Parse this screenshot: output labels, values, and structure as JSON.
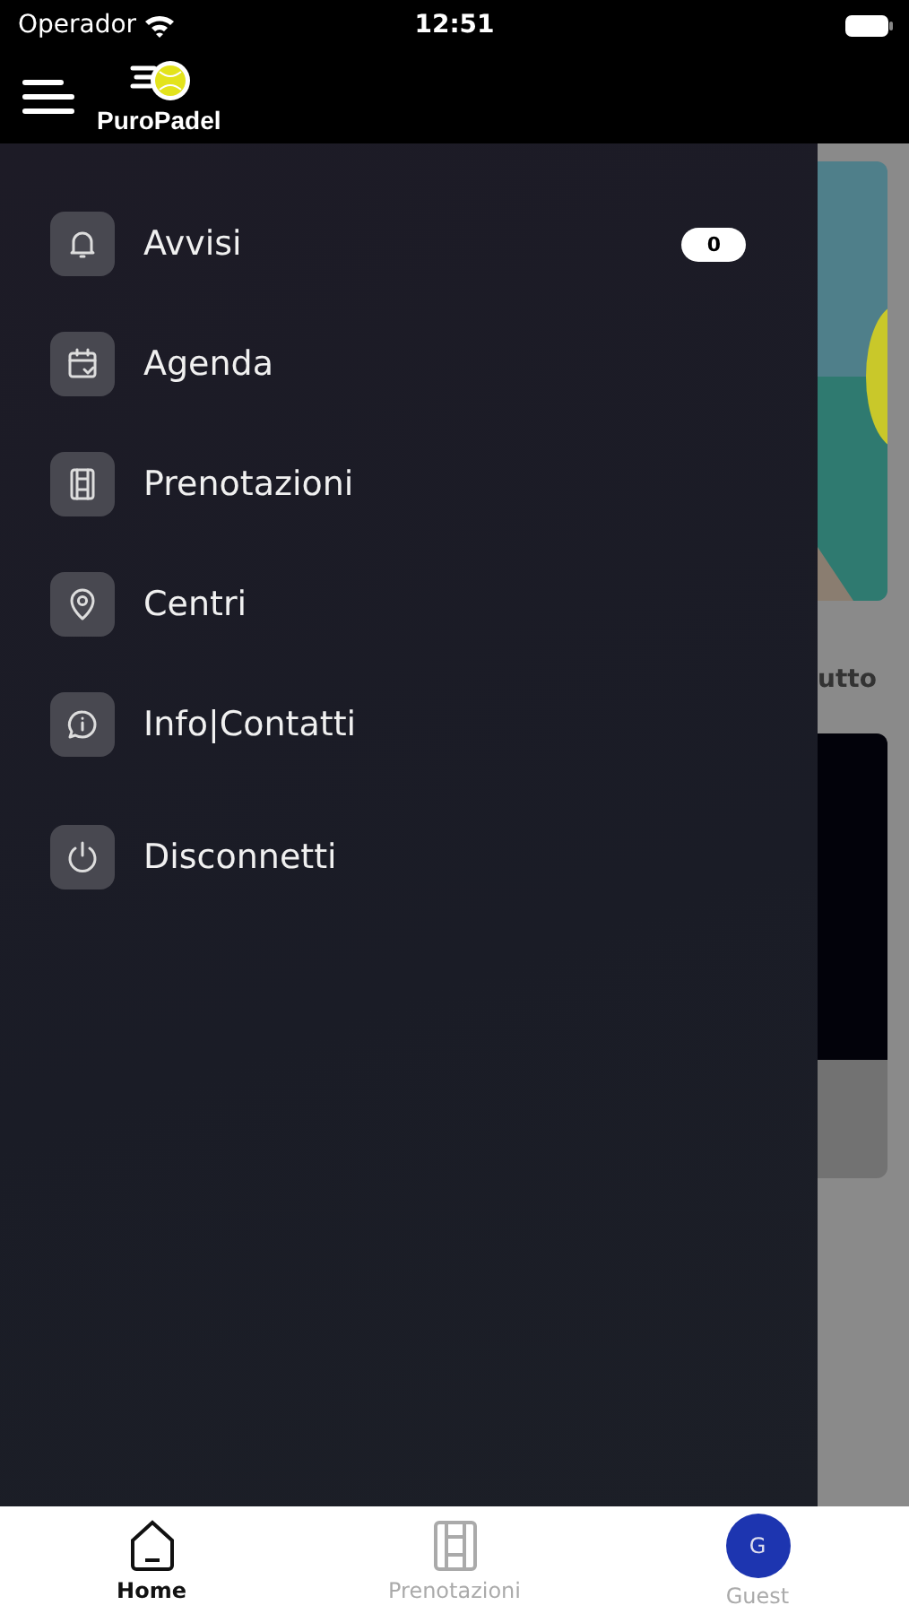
{
  "status_bar": {
    "carrier": "Operador",
    "time": "12:51"
  },
  "header": {
    "logo_text": "PuroPadel"
  },
  "drawer": {
    "items": [
      {
        "label": "Avvisi",
        "badge": "0"
      },
      {
        "label": "Agenda"
      },
      {
        "label": "Prenotazioni"
      },
      {
        "label": "Centri"
      },
      {
        "label": "Info|Contatti"
      },
      {
        "label": "Disconnetti"
      }
    ]
  },
  "background": {
    "link_text": "utto"
  },
  "tab_bar": [
    {
      "kind": "icon",
      "label": "Home",
      "selected": true
    },
    {
      "kind": "icon",
      "label": "Prenotazioni",
      "selected": false
    },
    {
      "kind": "avatar",
      "label": "Guest",
      "initial": "G",
      "selected": false
    }
  ]
}
